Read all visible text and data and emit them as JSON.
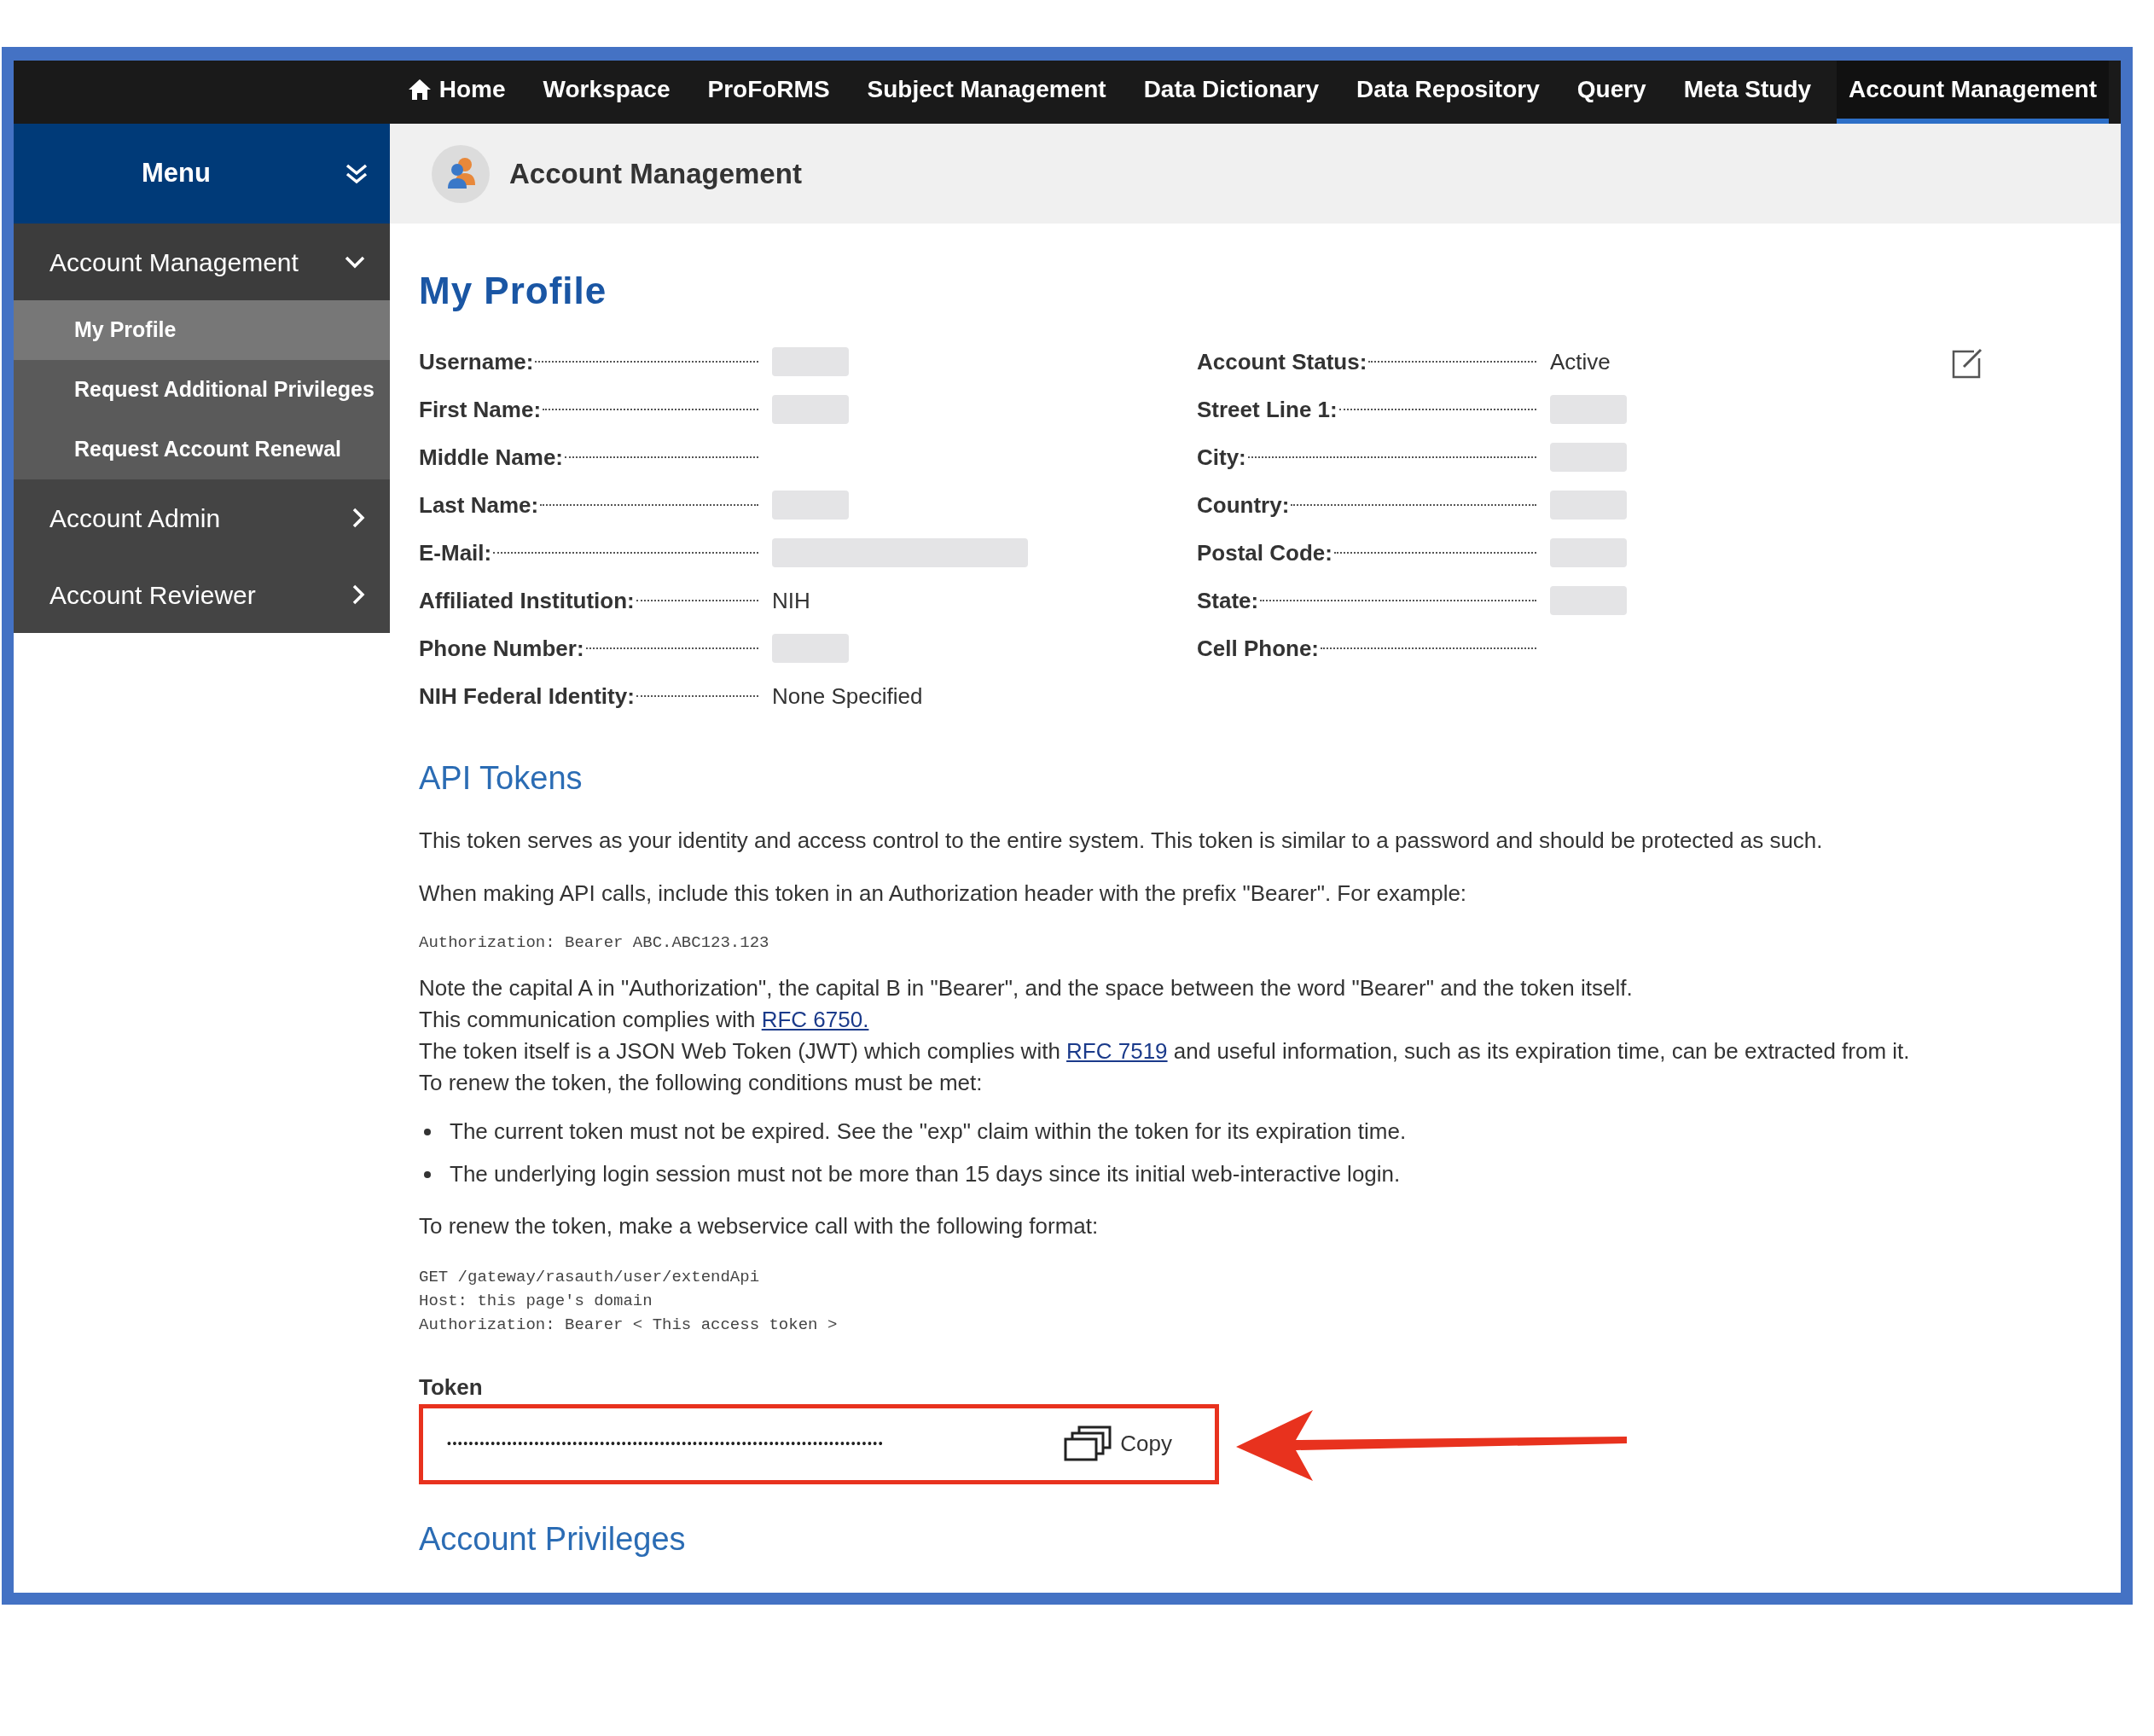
{
  "nav": [
    {
      "kind": "home",
      "label": "Home",
      "selected": false
    },
    {
      "kind": "link",
      "label": "Workspace",
      "selected": false
    },
    {
      "kind": "link",
      "label": "ProFoRMS",
      "selected": false
    },
    {
      "kind": "link",
      "label": "Subject Management",
      "selected": false
    },
    {
      "kind": "link",
      "label": "Data Dictionary",
      "selected": false
    },
    {
      "kind": "link",
      "label": "Data Repository",
      "selected": false
    },
    {
      "kind": "link",
      "label": "Query",
      "selected": false
    },
    {
      "kind": "link",
      "label": "Meta Study",
      "selected": false
    },
    {
      "kind": "link",
      "label": "Account Management",
      "selected": true
    }
  ],
  "sidebar": {
    "title": "Menu",
    "groups": [
      {
        "label": "Account Management",
        "expanded": true,
        "children": [
          {
            "label": "My Profile",
            "selected": true
          },
          {
            "label": "Request Additional Privileges",
            "selected": false
          },
          {
            "label": "Request Account Renewal",
            "selected": false
          }
        ]
      },
      {
        "label": "Account Admin",
        "expanded": false
      },
      {
        "label": "Account Reviewer",
        "expanded": false
      }
    ]
  },
  "page_header": {
    "title": "Account Management"
  },
  "profile": {
    "title": "My Profile",
    "left_fields": [
      {
        "label": "Username:",
        "kind": "blurred"
      },
      {
        "label": "First Name:",
        "kind": "blurred"
      },
      {
        "label": "Middle Name:",
        "kind": "empty"
      },
      {
        "label": "Last Name:",
        "kind": "blurred"
      },
      {
        "label": "E-Mail:",
        "kind": "blurred"
      },
      {
        "label": "Affiliated Institution:",
        "kind": "text",
        "value": "NIH"
      },
      {
        "label": "Phone Number:",
        "kind": "blurred"
      },
      {
        "label": "NIH Federal Identity:",
        "kind": "text",
        "value": "None Specified"
      }
    ],
    "right_fields": [
      {
        "label": "Account Status:",
        "kind": "text",
        "value": "Active"
      },
      {
        "label": "Street Line 1:",
        "kind": "blurred"
      },
      {
        "label": "City:",
        "kind": "blurred"
      },
      {
        "label": "Country:",
        "kind": "blurred"
      },
      {
        "label": "Postal Code:",
        "kind": "blurred"
      },
      {
        "label": "State:",
        "kind": "blurred"
      },
      {
        "label": "Cell Phone:",
        "kind": "empty"
      }
    ]
  },
  "api_tokens": {
    "title": "API Tokens",
    "intro": [
      "This token serves as your identity and access control to the entire system. This token is similar to a password and should be protected as such.",
      "When making API calls, include this token in an Authorization header with the prefix \"Bearer\". For example:"
    ],
    "example_code": [
      "Authorization: Bearer ABC.ABC123.123"
    ],
    "notes": [
      {
        "text": "Note the capital A in \"Authorization\", the capital B in \"Bearer\", and the space between the word \"Bearer\" and the token itself."
      },
      {
        "text": "This communication complies with ",
        "link": "RFC 6750."
      },
      {
        "text": "The token itself is a JSON Web Token (JWT) which complies with ",
        "link": "RFC 7519",
        "after": " and useful information, such as its expiration time, can be extracted from it."
      },
      {
        "text": "To renew the token, the following conditions must be met:"
      }
    ],
    "conditions": [
      "The current token must not be expired. See the \"exp\" claim within the token for its expiration time.",
      "The underlying login session must not be more than 15 days since its initial web-interactive login."
    ],
    "renew_text": "To renew the token, make a webservice call with the following format:",
    "renew_code": [
      "GET /gateway/rasauth/user/extendApi",
      "Host: this page's domain",
      "Authorization: Bearer < This access token >"
    ],
    "token": {
      "label": "Token",
      "value": "••••••••••••••••••••••••••••••••••••••••••••••••••••••••••••••••••••••••••••••••",
      "copy": "Copy",
      "highlighted": true
    }
  },
  "account_privileges": {
    "title": "Account Privileges"
  }
}
